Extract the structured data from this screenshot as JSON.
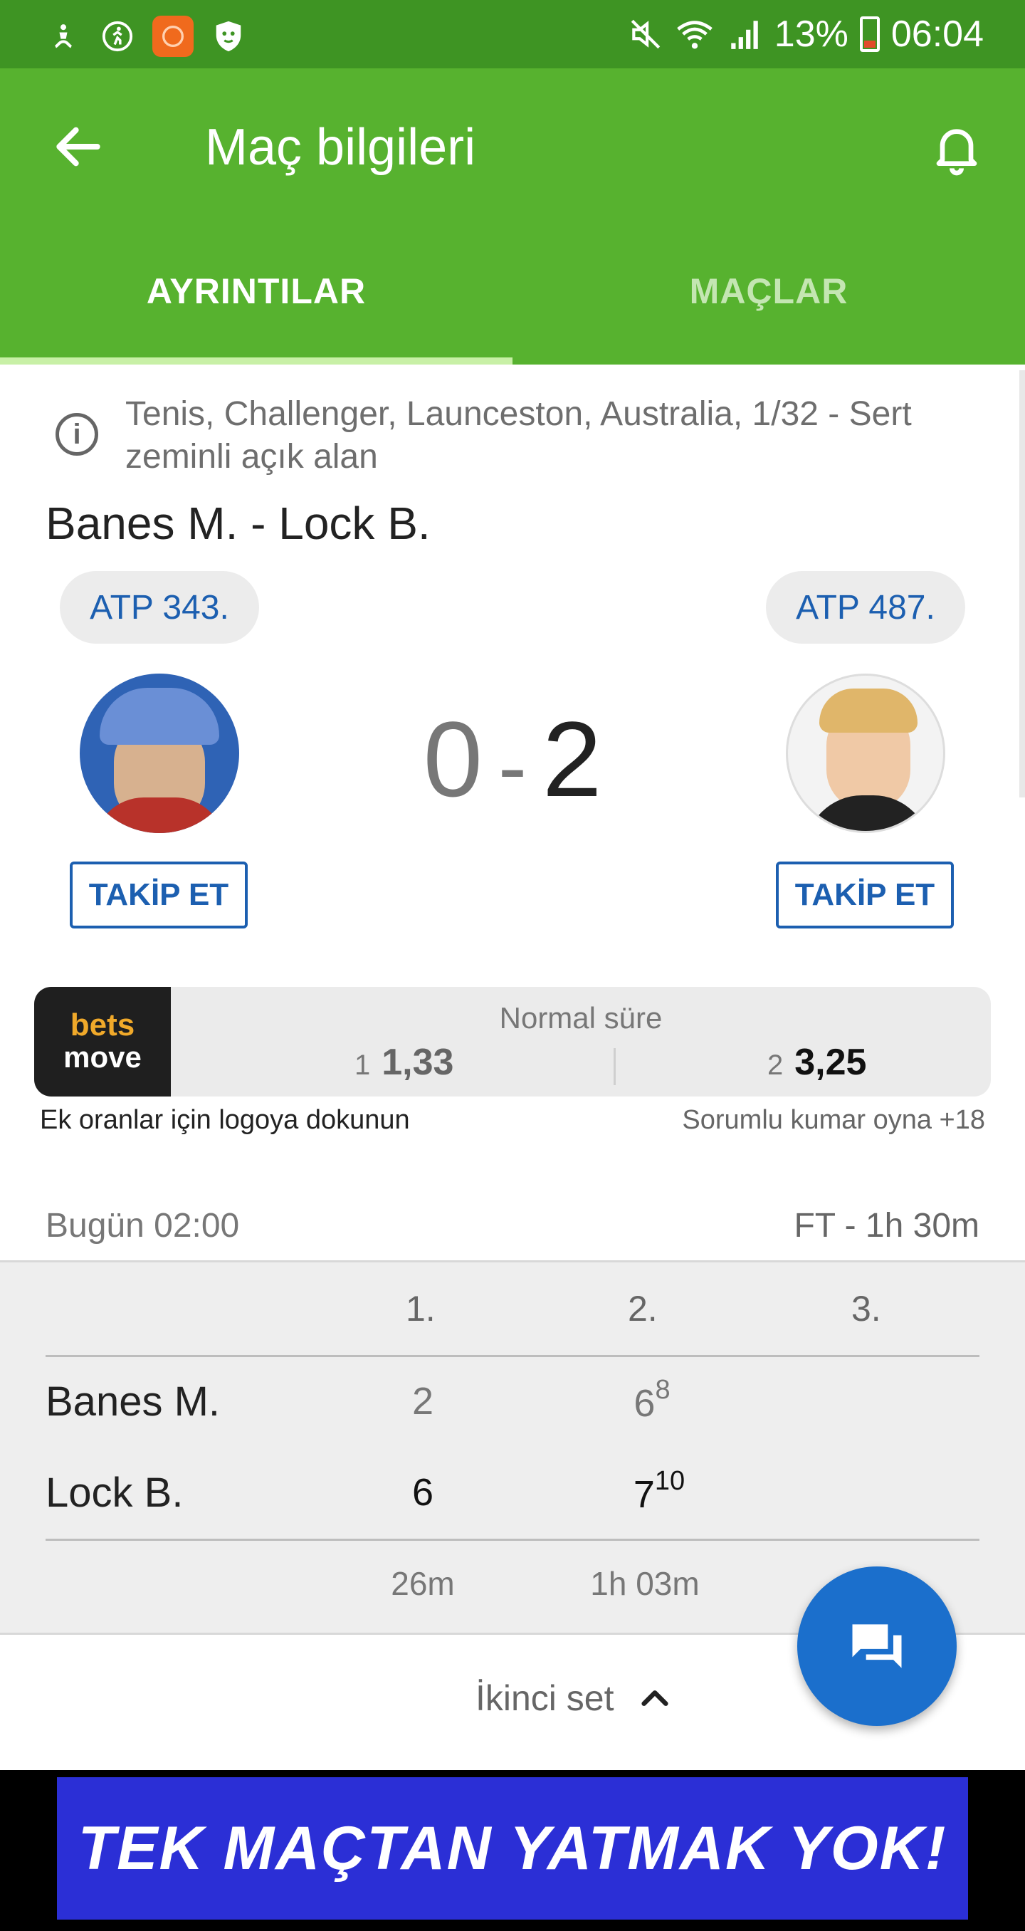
{
  "statusbar": {
    "battery": "13%",
    "time": "06:04",
    "left_icons": [
      "accessibility-icon",
      "runner-icon",
      "orange-app-icon",
      "shield-app-icon"
    ],
    "right_icons": [
      "mute-icon",
      "wifi-icon",
      "signal-icon",
      "battery-icon"
    ]
  },
  "appbar": {
    "title": "Maç bilgileri",
    "tabs": [
      {
        "label": "AYRINTILAR",
        "active": true
      },
      {
        "label": "MAÇLAR",
        "active": false
      }
    ]
  },
  "match": {
    "info": "Tenis, Challenger, Launceston, Australia, 1/32 - Sert zeminli açık alan",
    "title": "Banes M. - Lock B.",
    "player1": {
      "rank": "ATP 343.",
      "follow": "TAKİP ET"
    },
    "player2": {
      "rank": "ATP 487.",
      "follow": "TAKİP ET"
    },
    "score": {
      "home": "0",
      "sep": "-",
      "away": "2"
    }
  },
  "odds": {
    "brand_line1": "bets",
    "brand_line2": "move",
    "header": "Normal süre",
    "o1": {
      "label": "1",
      "value": "1,33"
    },
    "o2": {
      "label": "2",
      "value": "3,25"
    },
    "note_left": "Ek oranlar için logoya dokunun",
    "note_right": "Sorumlu kumar oyna +18"
  },
  "schedule": {
    "start": "Bugün 02:00",
    "status": "FT - 1h 30m"
  },
  "sets": {
    "headers": [
      "1.",
      "2.",
      "3."
    ],
    "rows": [
      {
        "name": "Banes M.",
        "s1": "2",
        "s2": "6",
        "s2_tb": "8",
        "s3": ""
      },
      {
        "name": "Lock B.",
        "s1": "6",
        "s2": "7",
        "s2_tb": "10",
        "s3": ""
      }
    ],
    "durations": [
      "26m",
      "1h 03m"
    ]
  },
  "toggle": {
    "label": "İkinci set"
  },
  "ad": {
    "text": "TEK MAÇTAN YATMAK YOK!"
  },
  "colors": {
    "statusbar": "#3e9423",
    "appbar": "#57b22f",
    "accent_blue": "#1c5fb0",
    "fab": "#1b6fcc"
  }
}
